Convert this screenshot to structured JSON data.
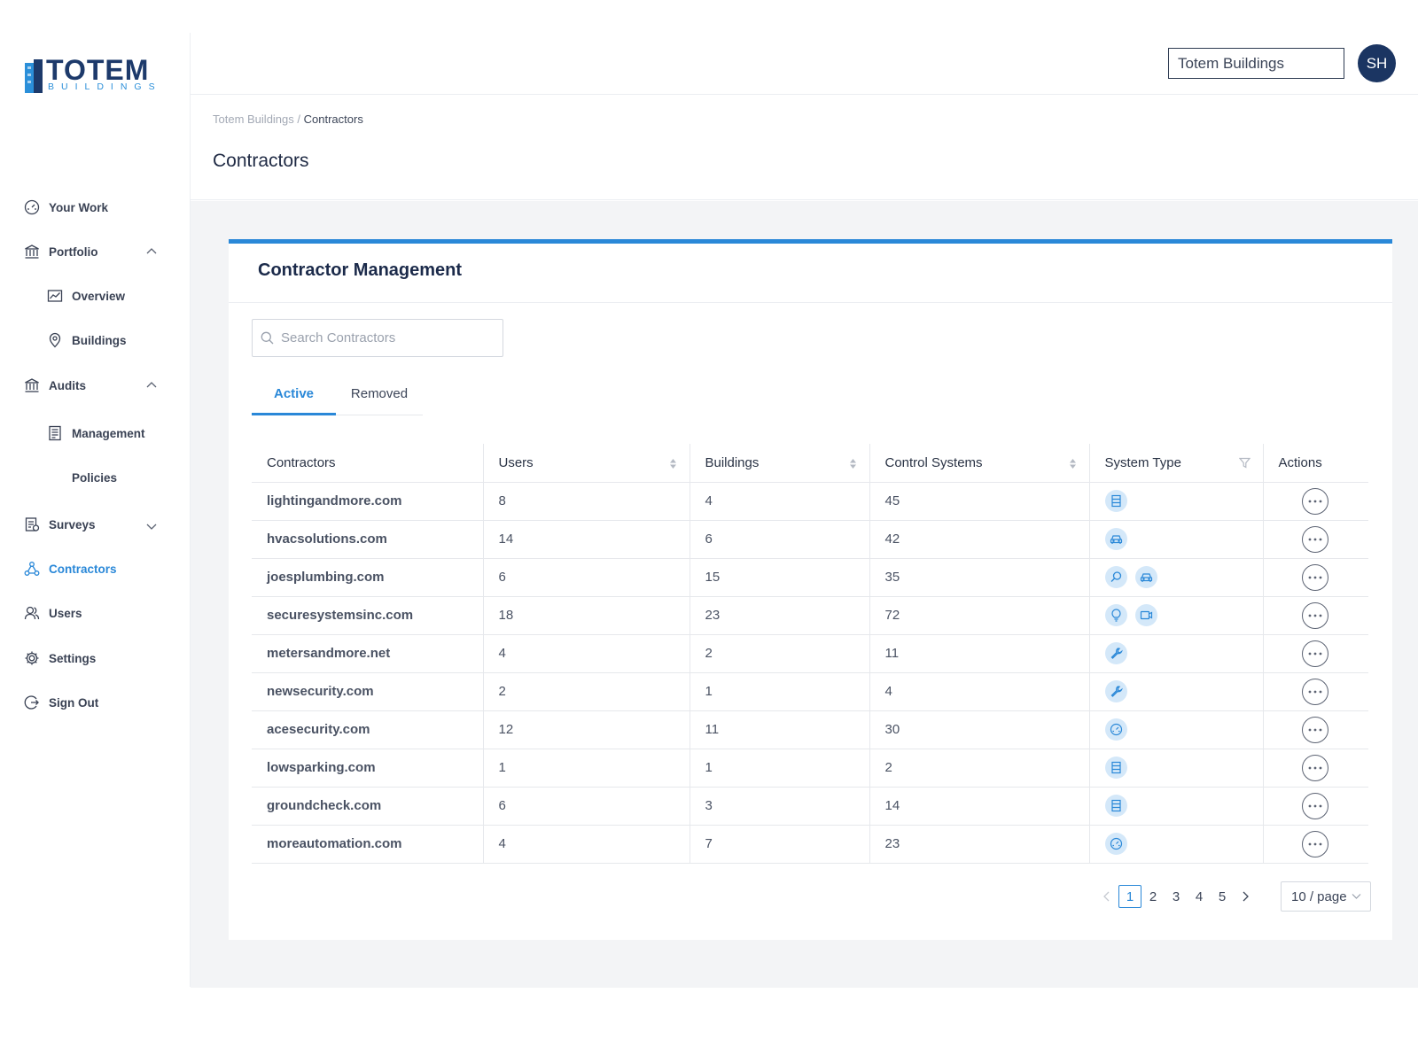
{
  "brand": {
    "name": "TOTEM",
    "subtitle": "BUILDINGS",
    "primary": "#1d3a6b",
    "accent": "#2a88d8"
  },
  "topbar": {
    "org_selected": "Totem Buildings",
    "avatar_initials": "SH"
  },
  "sidebar": {
    "items": [
      {
        "label": "Your Work",
        "icon": "dashboard-gauge-icon"
      },
      {
        "label": "Portfolio",
        "icon": "bank-building-icon",
        "expanded": true
      },
      {
        "label": "Overview",
        "icon": "line-chart-icon"
      },
      {
        "label": "Buildings",
        "icon": "map-pin-icon"
      },
      {
        "label": "Audits",
        "icon": "bank-building-icon",
        "expanded": true
      },
      {
        "label": "Management",
        "icon": "document-list-icon"
      },
      {
        "label": "Policies"
      },
      {
        "label": "Surveys",
        "icon": "clipboard-icon",
        "expanded": false
      },
      {
        "label": "Contractors",
        "icon": "network-nodes-icon",
        "active": true
      },
      {
        "label": "Users",
        "icon": "users-icon"
      },
      {
        "label": "Settings",
        "icon": "gear-icon"
      },
      {
        "label": "Sign Out",
        "icon": "sign-out-icon"
      }
    ]
  },
  "breadcrumb": {
    "parent": "Totem Buildings",
    "separator": " / ",
    "current": "Contractors"
  },
  "page": {
    "title": "Contractors"
  },
  "card": {
    "title": "Contractor Management",
    "search_placeholder": "Search Contractors",
    "tabs": [
      {
        "label": "Active",
        "active": true
      },
      {
        "label": "Removed",
        "active": false
      }
    ]
  },
  "table": {
    "headers": [
      "Contractors",
      "Users",
      "Buildings",
      "Control Systems",
      "System Type",
      "Actions"
    ],
    "rows": [
      {
        "name": "lightingandmore.com",
        "users": "8",
        "buildings": "4",
        "control_systems": "45",
        "system_types": [
          "server-rack-icon"
        ]
      },
      {
        "name": "hvacsolutions.com",
        "users": "14",
        "buildings": "6",
        "control_systems": "42",
        "system_types": [
          "car-icon"
        ]
      },
      {
        "name": "joesplumbing.com",
        "users": "6",
        "buildings": "15",
        "control_systems": "35",
        "system_types": [
          "magnifier-icon",
          "car-icon"
        ]
      },
      {
        "name": "securesystemsinc.com",
        "users": "18",
        "buildings": "23",
        "control_systems": "72",
        "system_types": [
          "lightbulb-icon",
          "video-camera-icon"
        ]
      },
      {
        "name": "metersandmore.net",
        "users": "4",
        "buildings": "2",
        "control_systems": "11",
        "system_types": [
          "wrench-icon"
        ]
      },
      {
        "name": "newsecurity.com",
        "users": "2",
        "buildings": "1",
        "control_systems": "4",
        "system_types": [
          "wrench-icon"
        ]
      },
      {
        "name": "acesecurity.com",
        "users": "12",
        "buildings": "11",
        "control_systems": "30",
        "system_types": [
          "gauge-icon"
        ]
      },
      {
        "name": "lowsparking.com",
        "users": "1",
        "buildings": "1",
        "control_systems": "2",
        "system_types": [
          "server-rack-icon"
        ]
      },
      {
        "name": "groundcheck.com",
        "users": "6",
        "buildings": "3",
        "control_systems": "14",
        "system_types": [
          "server-rack-icon"
        ]
      },
      {
        "name": "moreautomation.com",
        "users": "4",
        "buildings": "7",
        "control_systems": "23",
        "system_types": [
          "gauge-icon"
        ]
      }
    ]
  },
  "pagination": {
    "pages": [
      "1",
      "2",
      "3",
      "4",
      "5"
    ],
    "current": "1",
    "page_size": "10 / page"
  }
}
